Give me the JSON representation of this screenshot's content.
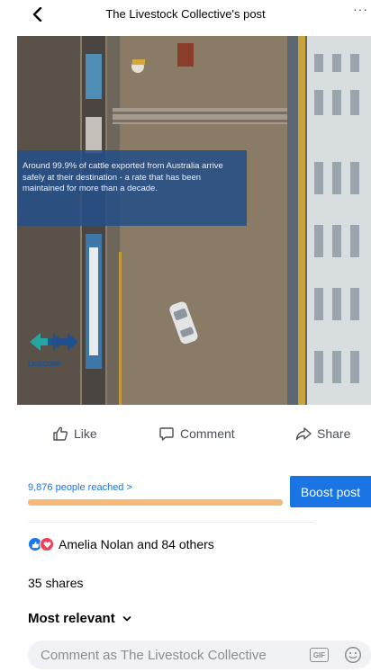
{
  "header": {
    "title": "The Livestock Collective's post",
    "more_label": "···"
  },
  "post": {
    "caption": "Around 99.9% of cattle exported from Australia arrive safely at their destination - a rate that has been maintained for more than a decade.",
    "logo_text": "LIVECORP"
  },
  "actions": {
    "like_label": "Like",
    "comment_label": "Comment",
    "share_label": "Share"
  },
  "insights": {
    "reach_label": "9,876 people reached >",
    "reach_progress": 1.0,
    "boost_label": "Boost post"
  },
  "engagement": {
    "reactions_label": "Amelia Nolan and 84 others",
    "shares_label": "35 shares"
  },
  "comments": {
    "sort_label": "Most relevant",
    "input_placeholder": "Comment as The Livestock Collective",
    "gif_label": "GIF"
  },
  "colors": {
    "accent": "#1b74e4",
    "progress": "#f5b97a",
    "caption_bg": "#244f86"
  }
}
